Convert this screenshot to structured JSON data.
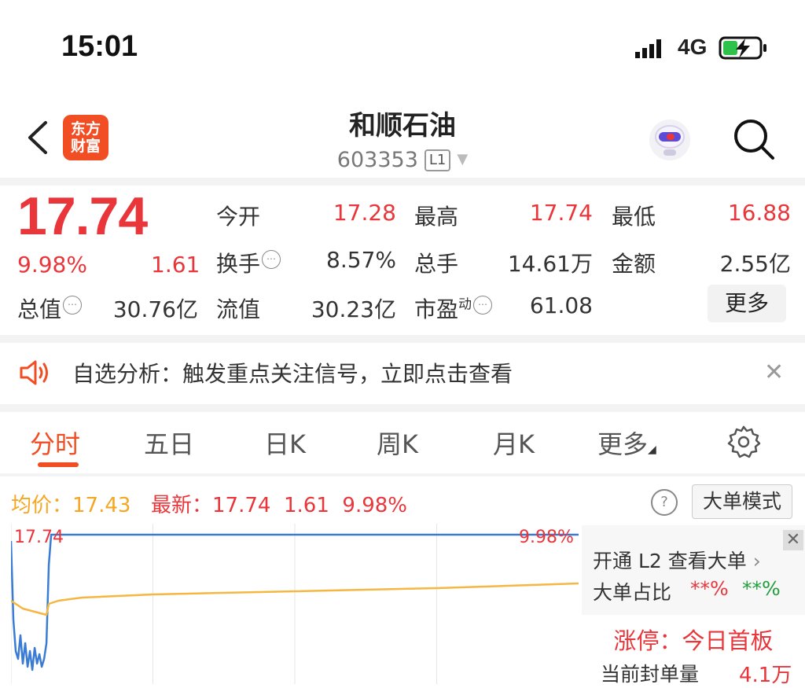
{
  "status_bar": {
    "time": "15:01",
    "network": "4G"
  },
  "header": {
    "logo_line1": "东方",
    "logo_line2": "财富",
    "stock_name": "和顺石油",
    "stock_code": "603353",
    "level_badge": "L1"
  },
  "quote": {
    "price": "17.74",
    "change_pct": "9.98%",
    "change_abs": "1.61",
    "fields": {
      "open_label": "今开",
      "open_value": "17.28",
      "high_label": "最高",
      "high_value": "17.74",
      "low_label": "最低",
      "low_value": "16.88",
      "turnover_label": "换手",
      "turnover_value": "8.57%",
      "volume_label": "总手",
      "volume_value": "14.61万",
      "amount_label": "金额",
      "amount_value": "2.55亿",
      "total_mv_label": "总值",
      "total_mv_value": "30.76亿",
      "float_mv_label": "流值",
      "float_mv_value": "30.23亿",
      "pe_label": "市盈",
      "pe_super": "动",
      "pe_value": "61.08"
    },
    "more_label": "更多"
  },
  "notice": {
    "text": "自选分析：触发重点关注信号，立即点击查看"
  },
  "tabs": [
    {
      "label": "分时",
      "active": true
    },
    {
      "label": "五日",
      "active": false
    },
    {
      "label": "日K",
      "active": false
    },
    {
      "label": "周K",
      "active": false
    },
    {
      "label": "月K",
      "active": false
    },
    {
      "label": "更多",
      "active": false
    }
  ],
  "chart_header": {
    "avg_label": "均价：",
    "avg_value": "17.43",
    "latest_label": "最新：",
    "latest_value": "17.74",
    "latest_change": "1.61",
    "latest_pct": "9.98%",
    "mode_button": "大单模式"
  },
  "chart_data": {
    "type": "line",
    "title": "",
    "top_label": "17.74",
    "top_pct_label": "9.98%",
    "ylim": [
      16.8,
      17.8
    ],
    "xlim": [
      0,
      240
    ],
    "series": [
      {
        "color": "#3a7bd5",
        "x": [
          0,
          1,
          2,
          3,
          4,
          5,
          6,
          7,
          8,
          9,
          10,
          11,
          12,
          13,
          14,
          15,
          16,
          17,
          18,
          20,
          30,
          60,
          120,
          180,
          240
        ],
        "values": [
          17.7,
          17.2,
          17.0,
          16.95,
          17.1,
          16.92,
          17.05,
          16.9,
          17.0,
          16.88,
          17.02,
          16.92,
          16.98,
          16.9,
          16.95,
          17.05,
          17.55,
          17.74,
          17.74,
          17.74,
          17.74,
          17.74,
          17.74,
          17.74,
          17.74
        ]
      },
      {
        "color": "#f5b642",
        "x": [
          0,
          5,
          10,
          15,
          16,
          20,
          30,
          60,
          120,
          180,
          240
        ],
        "values": [
          17.32,
          17.27,
          17.25,
          17.23,
          17.3,
          17.32,
          17.34,
          17.36,
          17.38,
          17.4,
          17.43
        ]
      }
    ]
  },
  "side_panel": {
    "open_text": "开通 L2 查看大单",
    "ratio_label": "大单占比",
    "ratio_red": "**%",
    "ratio_green": "**%",
    "limit_up_text": "涨停：今日首板",
    "seal_label": "当前封单量",
    "seal_value": "4.1万"
  },
  "colors": {
    "up_red": "#e8363b",
    "accent_orange": "#f04d22",
    "avg_line": "#f5b642",
    "price_line": "#3a7bd5",
    "down_green": "#1e9f3c"
  },
  "icons": [
    "signal-icon",
    "battery-charging-icon",
    "back-icon",
    "robot-icon",
    "search-icon",
    "info-icon",
    "speaker-icon",
    "close-icon",
    "gear-icon",
    "help-icon"
  ]
}
